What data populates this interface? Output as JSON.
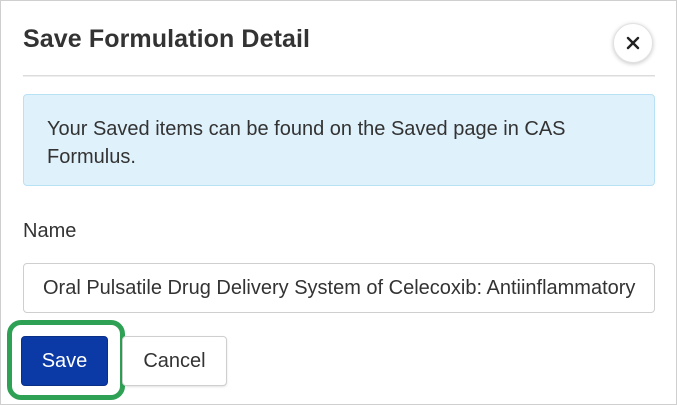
{
  "dialog": {
    "title": "Save Formulation Detail",
    "close_icon": "close-icon",
    "info_message": "Your Saved items can be found on the Saved page in CAS Formulus.",
    "name_label": "Name",
    "name_value": "Oral Pulsatile Drug Delivery System of Celecoxib: Antiinflammatory",
    "save_label": "Save",
    "cancel_label": "Cancel"
  },
  "colors": {
    "primary": "#0b3aa6",
    "info_background": "#dff1fb",
    "info_border": "#b9e1f5",
    "highlight": "#2fa155",
    "text": "#333333"
  }
}
